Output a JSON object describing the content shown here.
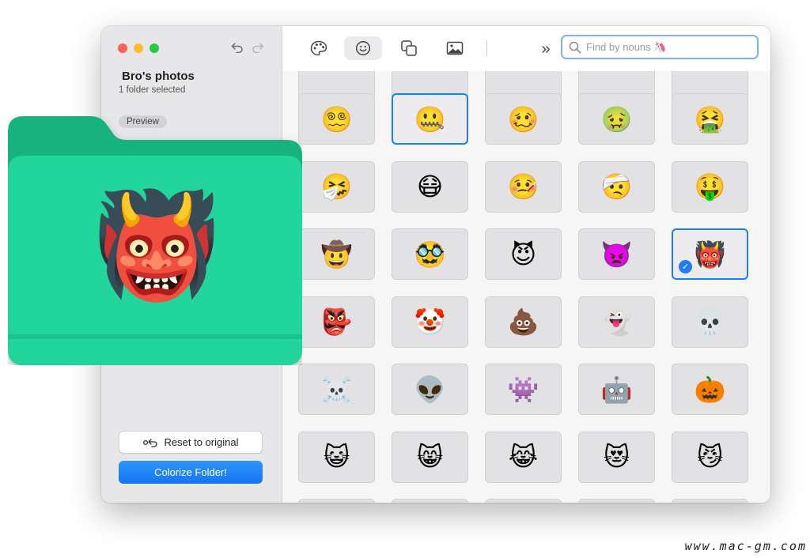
{
  "sidebar": {
    "title": "Bro's photos",
    "subtitle": "1 folder selected",
    "preview_label": "Preview",
    "reset_label": "Reset to original",
    "colorize_label": "Colorize Folder!"
  },
  "toolbar": {
    "tabs": [
      {
        "name": "palette-icon",
        "active": false
      },
      {
        "name": "smiley-icon",
        "active": true
      },
      {
        "name": "shapes-icon",
        "active": false
      },
      {
        "name": "image-icon",
        "active": false
      }
    ],
    "more_label": "»",
    "search_placeholder": "Find by nouns 🦄"
  },
  "folder_preview": {
    "color": "#21d99c",
    "emoji": "👹"
  },
  "grid": {
    "rows": [
      [
        "😵‍💫",
        "🤐",
        "🥴",
        "🤢",
        "🤮"
      ],
      [
        "🤧",
        "😷",
        "🤒",
        "🤕",
        "🤑"
      ],
      [
        "🤠",
        "🥸",
        "😈",
        "👿",
        "👹"
      ],
      [
        "👺",
        "🤡",
        "💩",
        "👻",
        "💀"
      ],
      [
        "☠️",
        "👽",
        "👾",
        "🤖",
        "🎃"
      ],
      [
        "😺",
        "😸",
        "😹",
        "😻",
        "😼"
      ]
    ],
    "selected": [
      {
        "row": 0,
        "col": 1,
        "style": "focused"
      },
      {
        "row": 2,
        "col": 4,
        "style": "checked"
      }
    ],
    "check_mark": "✓"
  },
  "watermark": "www.mac-gm.com"
}
